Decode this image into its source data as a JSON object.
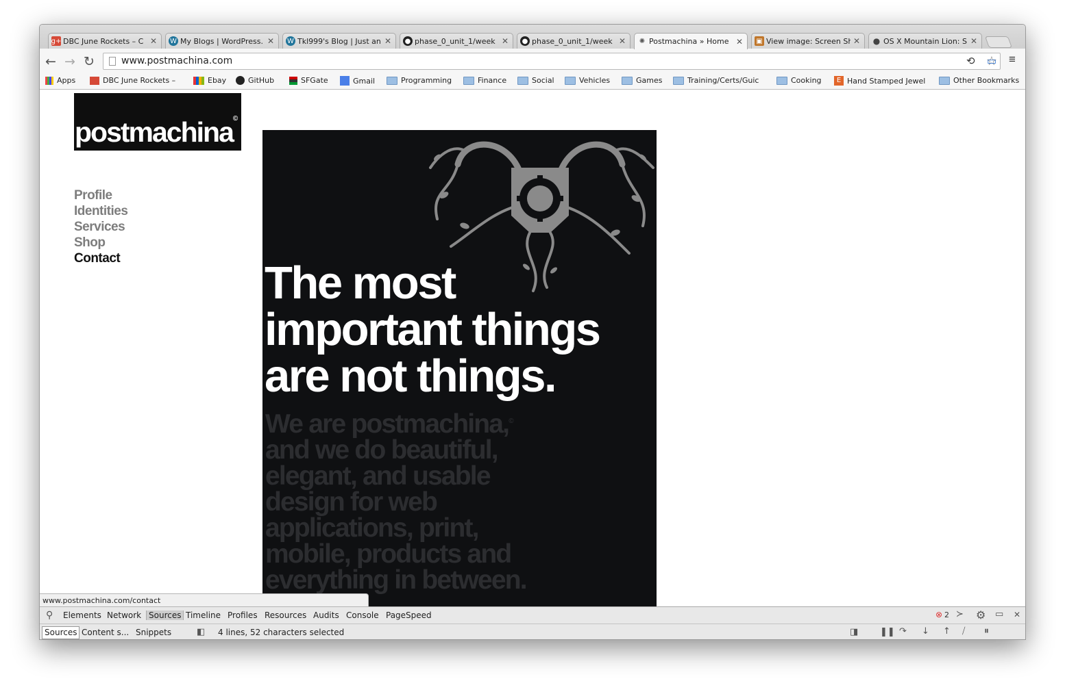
{
  "tabs": [
    {
      "title": "DBC June Rockets – C",
      "icon": "google-plus-icon",
      "color": "#d64937",
      "glyph": "g+"
    },
    {
      "title": "My Blogs | WordPress.",
      "icon": "wordpress-icon",
      "color": "#21759b",
      "glyph": "W"
    },
    {
      "title": "Tkl999's Blog | Just an",
      "icon": "wordpress-icon",
      "color": "#21759b",
      "glyph": "W"
    },
    {
      "title": "phase_0_unit_1/week",
      "icon": "github-icon",
      "color": "#222222",
      "glyph": "●"
    },
    {
      "title": "phase_0_unit_1/week",
      "icon": "github-icon",
      "color": "#222222",
      "glyph": "●"
    },
    {
      "title": "Postmachina » Home",
      "icon": "postmachina-icon",
      "color": "#666666",
      "glyph": "✺"
    },
    {
      "title": "View image: Screen Sh",
      "icon": "image-icon",
      "color": "#c0762a",
      "glyph": "▣"
    },
    {
      "title": "OS X Mountain Lion: S",
      "icon": "apple-icon",
      "color": "#555555",
      "glyph": ""
    }
  ],
  "address": {
    "url": "www.postmachina.com"
  },
  "bookmarks": [
    {
      "label": "Apps",
      "icon": "apps-icon"
    },
    {
      "label": "DBC June Rockets – ",
      "icon": "google-plus-icon"
    },
    {
      "label": "Ebay",
      "icon": "ebay-icon"
    },
    {
      "label": "GitHub",
      "icon": "github-icon"
    },
    {
      "label": "SFGate",
      "icon": "sfgate-icon"
    },
    {
      "label": "Gmail",
      "icon": "gmail-icon"
    },
    {
      "label": "Programming",
      "icon": "folder-icon"
    },
    {
      "label": "Finance",
      "icon": "folder-icon"
    },
    {
      "label": "Social",
      "icon": "folder-icon"
    },
    {
      "label": "Vehicles",
      "icon": "folder-icon"
    },
    {
      "label": "Games",
      "icon": "folder-icon"
    },
    {
      "label": "Training/Certs/Guic",
      "icon": "folder-icon"
    },
    {
      "label": "Cooking",
      "icon": "folder-icon"
    },
    {
      "label": "Hand Stamped Jewel",
      "icon": "etsy-icon"
    },
    {
      "label": "Other Bookmarks",
      "icon": "folder-icon"
    }
  ],
  "site": {
    "logo": "postmachina",
    "logo_mark": "©",
    "nav": [
      "Profile",
      "Identities",
      "Services",
      "Shop",
      "Contact"
    ],
    "headline": [
      "The most",
      "important things",
      "are not things."
    ],
    "tagline": [
      "We are postmachina,",
      "and we do beautiful,",
      "elegant, and usable",
      "design for web",
      "applications, print,",
      "mobile, products and",
      "everything in between."
    ],
    "tagline_mark": "©"
  },
  "status_url": "www.postmachina.com/contact",
  "devtools": {
    "tabs": [
      "Elements",
      "Network",
      "Sources",
      "Timeline",
      "Profiles",
      "Resources",
      "Audits",
      "Console",
      "PageSpeed"
    ],
    "selected_tab": "Sources",
    "subtabs": [
      "Sources",
      "Content s...",
      "Snippets"
    ],
    "selection_status": "4 lines, 52 characters selected",
    "error_count": "2"
  }
}
